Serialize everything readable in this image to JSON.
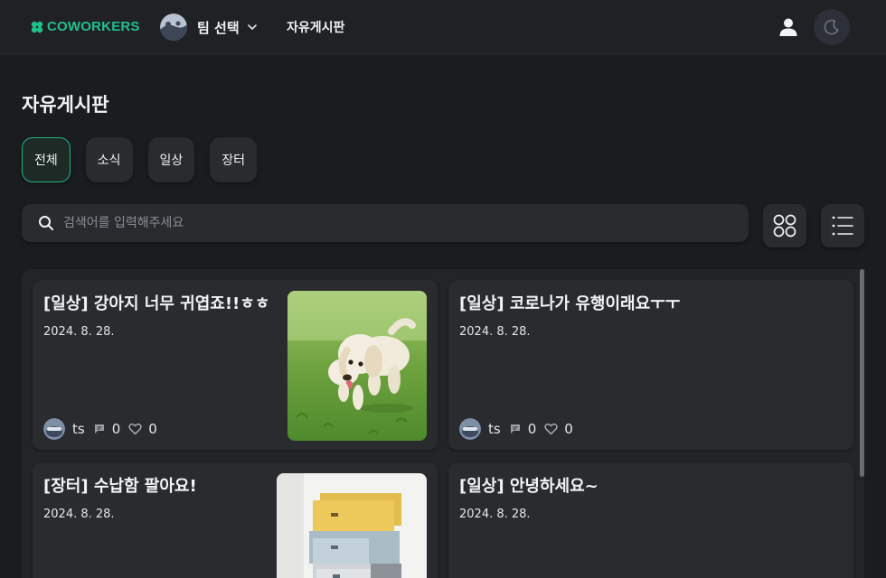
{
  "header": {
    "logo_text": "COWORKERS",
    "team_name": "팀 선택",
    "nav_link": "자유게시판",
    "icons": {
      "logo": "clover-logo-icon",
      "team_avatar": "team-avatar-icon",
      "team_dropdown": "chevron-down-icon",
      "user": "user-icon",
      "theme": "moon-icon"
    }
  },
  "page": {
    "title": "자유게시판"
  },
  "categories": [
    {
      "label": "전체",
      "active": true
    },
    {
      "label": "소식",
      "active": false
    },
    {
      "label": "일상",
      "active": false
    },
    {
      "label": "장터",
      "active": false
    }
  ],
  "search": {
    "placeholder": "검색어를 입력해주세요",
    "value": ""
  },
  "view_toggle": {
    "grid_icon": "grid-view-icon",
    "list_icon": "list-view-icon"
  },
  "posts": [
    {
      "title": "[일상] 강아지 너무 귀엽죠!!ㅎㅎ",
      "date": "2024. 8. 28.",
      "author": "ts",
      "comments": "0",
      "likes": "0",
      "image": "puppy-photo"
    },
    {
      "title": "[일상] 코로나가 유행이래요ㅜㅜ",
      "date": "2024. 8. 28.",
      "author": "ts",
      "comments": "0",
      "likes": "0",
      "image": ""
    },
    {
      "title": "[장터] 수납함 팔아요!",
      "date": "2024. 8. 28.",
      "author": "",
      "comments": "",
      "likes": "",
      "image": "storage-drawer-photo"
    },
    {
      "title": "[일상] 안녕하세요~",
      "date": "2024. 8. 28.",
      "author": "",
      "comments": "",
      "likes": "",
      "image": ""
    }
  ],
  "colors": {
    "accent": "#20c08a",
    "background": "#1b1c1f",
    "surface": "#2a2b2f"
  }
}
